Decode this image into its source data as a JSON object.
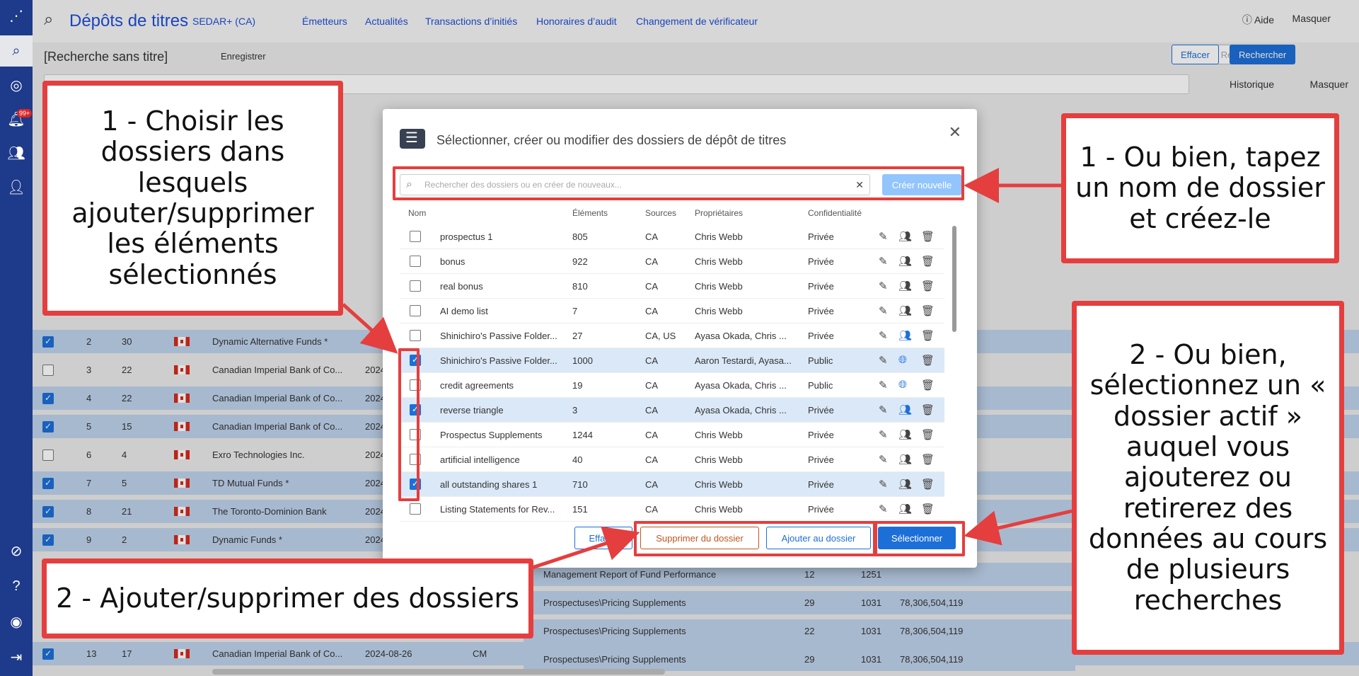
{
  "rail": {
    "badge": "99+"
  },
  "header": {
    "title": "Dépôts de titres",
    "subtitle": "SEDAR+ (CA)",
    "nav": [
      "Émetteurs",
      "Actualités",
      "Transactions d’initiés",
      "Honoraires d’audit",
      "Changement de vérificateur"
    ],
    "help": "Aide",
    "hide": "Masquer"
  },
  "toolbar": {
    "search_title": "[Recherche sans titre]",
    "save": "Enregistrer",
    "reset": "Réinitialiser",
    "clear": "Effacer",
    "search": "Rechercher",
    "history": "Historique",
    "hide": "Masquer"
  },
  "background_rows": [
    {
      "n": "2",
      "v": "30",
      "name": "Dynamic Alternative Funds *",
      "date": "",
      "type": "",
      "sel": true
    },
    {
      "n": "3",
      "v": "22",
      "name": "Canadian Imperial Bank of Co...",
      "date": "2024",
      "type": "",
      "sel": false
    },
    {
      "n": "4",
      "v": "22",
      "name": "Canadian Imperial Bank of Co...",
      "date": "2024",
      "type": "",
      "sel": true
    },
    {
      "n": "5",
      "v": "15",
      "name": "Canadian Imperial Bank of Co...",
      "date": "2024",
      "type": "",
      "sel": true
    },
    {
      "n": "6",
      "v": "4",
      "name": "Exro Technologies Inc.",
      "date": "2024",
      "type": "",
      "sel": false
    },
    {
      "n": "7",
      "v": "5",
      "name": "TD Mutual Funds *",
      "date": "2024",
      "type": "",
      "sel": true
    },
    {
      "n": "8",
      "v": "21",
      "name": "The Toronto-Dominion Bank",
      "date": "2024",
      "type": "",
      "sel": true
    },
    {
      "n": "9",
      "v": "2",
      "name": "Dynamic Funds *",
      "date": "2024",
      "type": "",
      "sel": true
    },
    {
      "n": "13",
      "v": "17",
      "name": "Canadian Imperial Bank of Co...",
      "date": "2024-08-26",
      "type": "CM",
      "sel": true
    }
  ],
  "background_docs": [
    {
      "doc": "Management Report of Fund Performance",
      "a": "12",
      "b": "1251",
      "c": ""
    },
    {
      "doc": "Prospectuses\\Pricing Supplements",
      "a": "29",
      "b": "1031",
      "c": "78,306,504,119"
    },
    {
      "doc": "Prospectuses\\Pricing Supplements",
      "a": "22",
      "b": "1031",
      "c": "78,306,504,119"
    },
    {
      "doc": "Prospectuses\\Pricing Supplements",
      "a": "29",
      "b": "1031",
      "c": "78,306,504,119"
    }
  ],
  "modal": {
    "title": "Sélectionner, créer ou modifier des dossiers de dépôt de titres",
    "search_placeholder": "Rechercher des dossiers ou en créer de nouveaux...",
    "create": "Créer nouvelle",
    "columns": [
      "Nom",
      "Éléments",
      "Sources",
      "Propriétaires",
      "Confidentialité"
    ],
    "rows": [
      {
        "name": "prospectus 1",
        "items": "805",
        "src": "CA",
        "owner": "Chris Webb",
        "conf": "Privée",
        "sel": false,
        "share": "people"
      },
      {
        "name": "bonus",
        "items": "922",
        "src": "CA",
        "owner": "Chris Webb",
        "conf": "Privée",
        "sel": false,
        "share": "people"
      },
      {
        "name": "real bonus",
        "items": "810",
        "src": "CA",
        "owner": "Chris Webb",
        "conf": "Privée",
        "sel": false,
        "share": "people"
      },
      {
        "name": "AI demo list",
        "items": "7",
        "src": "CA",
        "owner": "Chris Webb",
        "conf": "Privée",
        "sel": false,
        "share": "people"
      },
      {
        "name": "Shinichiro's Passive Folder...",
        "items": "27",
        "src": "CA, US",
        "owner": "Ayasa Okada, Chris ...",
        "conf": "Privée",
        "sel": false,
        "share": "people-blue"
      },
      {
        "name": "Shinichiro's Passive Folder...",
        "items": "1000",
        "src": "CA",
        "owner": "Aaron Testardi, Ayasa...",
        "conf": "Public",
        "sel": true,
        "share": "globe"
      },
      {
        "name": "credit agreements",
        "items": "19",
        "src": "CA",
        "owner": "Ayasa Okada, Chris ...",
        "conf": "Public",
        "sel": false,
        "share": "globe"
      },
      {
        "name": "reverse triangle",
        "items": "3",
        "src": "CA",
        "owner": "Ayasa Okada, Chris ...",
        "conf": "Privée",
        "sel": true,
        "share": "people-blue"
      },
      {
        "name": "Prospectus Supplements",
        "items": "1244",
        "src": "CA",
        "owner": "Chris Webb",
        "conf": "Privée",
        "sel": false,
        "share": "people"
      },
      {
        "name": "artificial intelligence",
        "items": "40",
        "src": "CA",
        "owner": "Chris Webb",
        "conf": "Privée",
        "sel": false,
        "share": "people"
      },
      {
        "name": "all outstanding shares 1",
        "items": "710",
        "src": "CA",
        "owner": "Chris Webb",
        "conf": "Privée",
        "sel": true,
        "share": "people"
      },
      {
        "name": "Listing Statements for Rev...",
        "items": "151",
        "src": "CA",
        "owner": "Chris Webb",
        "conf": "Privée",
        "sel": false,
        "share": "people"
      }
    ],
    "btn_clear": "Effacer",
    "btn_remove": "Supprimer du dossier",
    "btn_add": "Ajouter au dossier",
    "btn_select": "Sélectionner"
  },
  "annotations": {
    "a1_left": "1 - Choisir les dossiers dans lesquels ajouter/supprimer les éléments sélectionnés",
    "a1_right": "1 - Ou bien, tapez un nom de dossier et créez-le",
    "a2_bottom": "2 - Ajouter/supprimer des dossiers",
    "a2_right": "2 - Ou bien, sélectionnez un « dossier actif » auquel vous ajouterez ou retirerez des données au cours de plusieurs recherches"
  },
  "colors": {
    "accent": "#1d6fd8",
    "annotation": "#e53e3e",
    "rail": "#1e3a8a"
  }
}
